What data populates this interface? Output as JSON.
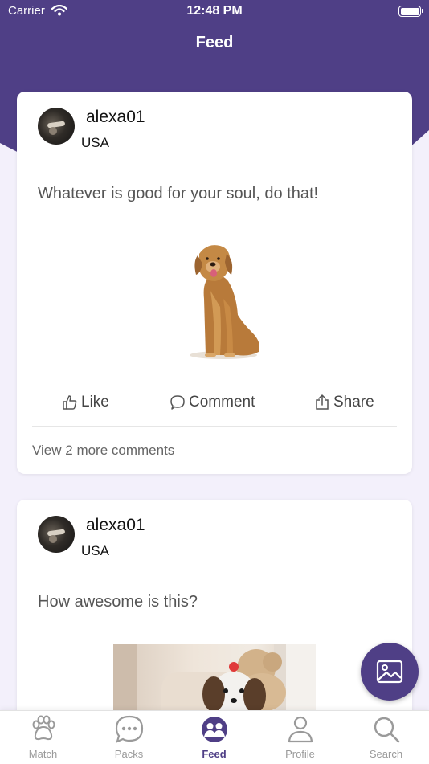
{
  "status_bar": {
    "carrier": "Carrier",
    "time": "12:48 PM"
  },
  "header": {
    "title": "Feed"
  },
  "posts": [
    {
      "username": "alexa01",
      "country": "USA",
      "text": "Whatever is good for your soul, do that!",
      "image": "golden-retriever-dog",
      "actions": {
        "like": "Like",
        "comment": "Comment",
        "share": "Share"
      },
      "view_more": "View 2 more comments"
    },
    {
      "username": "alexa01",
      "country": "USA",
      "text": "How awesome is this?",
      "image": "shih-tzu-dog-with-teddy-bear"
    }
  ],
  "fab": {
    "icon": "image-icon"
  },
  "tabbar": {
    "items": [
      {
        "label": "Match",
        "icon": "paw-icon"
      },
      {
        "label": "Packs",
        "icon": "chat-bubble-icon"
      },
      {
        "label": "Feed",
        "icon": "group-icon"
      },
      {
        "label": "Profile",
        "icon": "person-icon"
      },
      {
        "label": "Search",
        "icon": "search-icon"
      }
    ],
    "active": "Feed"
  },
  "colors": {
    "primary": "#4f3f86",
    "background": "#f3f0fb",
    "inactive": "#9a9a9a"
  }
}
